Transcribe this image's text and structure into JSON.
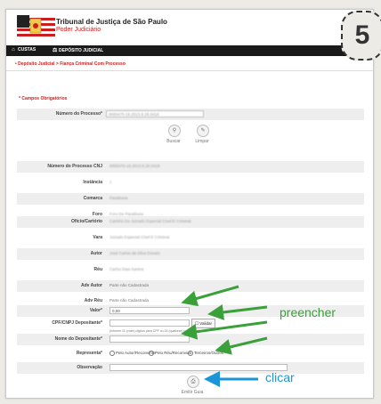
{
  "header": {
    "title": "Tribunal de Justiça de São Paulo",
    "subtitle": "Poder Judiciário"
  },
  "nav": {
    "items": [
      {
        "icon": "bank-icon",
        "label": "CUSTAS"
      },
      {
        "icon": "scales-icon",
        "label": "DEPÓSITO JUDICIAL"
      }
    ]
  },
  "breadcrumb": "• Depósito Judicial > Fiança Criminal Com Processo",
  "form": {
    "required_note": "* Campos Obrigatórios",
    "processo_label": "Número do Processo*",
    "processo_value": "0000470-19.2013.8.26.0418",
    "buscar_label": "Buscar",
    "limpar_label": "Limpar"
  },
  "details": [
    {
      "label": "Número do Processo CNJ",
      "value": "0000470-19.2013.8.26.0418",
      "blurred": true
    },
    {
      "label": "Instância",
      "value": "1",
      "blurred": true
    },
    {
      "label": "Comarca",
      "value": "Paraibuna",
      "blurred": true
    },
    {
      "label": "Foro",
      "value": "Foro De Paraibuna",
      "blurred": true
    },
    {
      "label": "Ofício/Cartório",
      "value": "Cartório Do Juizado Especial Cível E Criminal",
      "blurred": true
    },
    {
      "label": "Vara",
      "value": "Juizado Especial Cível E Criminal",
      "blurred": true
    },
    {
      "label": "Autor",
      "value": "José Carlos da Silva Donato",
      "blurred": true
    },
    {
      "label": "Réu",
      "value": "Carlos Dias Santos",
      "blurred": true
    },
    {
      "label": "Adv Autor",
      "value": "Parte não Cadastrada",
      "blurred": false
    },
    {
      "label": "Adv Réu",
      "value": "Parte não Cadastrada",
      "blurred": false
    }
  ],
  "inputs": {
    "valor_label": "Valor*",
    "valor_value": "0,00",
    "cpf_label": "CPF/CNPJ Depositante*",
    "cpf_hint": "(Informe 11 (onze) dígitos para CPF ou 14 (quatorze) para CNPJ)",
    "validar_label": "Validar",
    "nome_label": "Nome do Depositante*",
    "representa_label": "Representa*",
    "radio_options": [
      "Pelo Autor/Reconvinte",
      "Pelo Réu/Reconvida",
      "Terceiros/Outros"
    ],
    "observacao_label": "Observação",
    "emitir_label": "Emitir Guia"
  },
  "annotations": {
    "badge": "5",
    "preencher": "preencher",
    "clicar": "clicar",
    "green": "#3aa03a",
    "blue": "#1a96d8"
  }
}
